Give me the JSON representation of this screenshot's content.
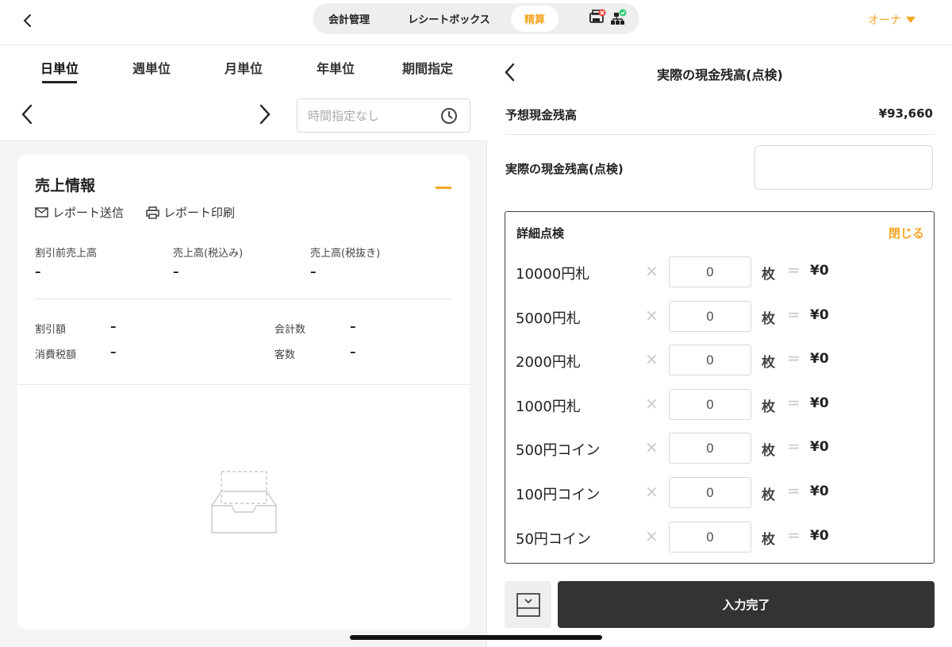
{
  "header": {
    "segments": [
      "会計管理",
      "レシートボックス",
      "精算"
    ],
    "active_segment": "精算",
    "owner_label": "オーナ"
  },
  "left": {
    "tabs": [
      "日単位",
      "週単位",
      "月単位",
      "年単位",
      "期間指定"
    ],
    "active_tab": "日単位",
    "time_placeholder": "時間指定なし",
    "card": {
      "title": "売上情報",
      "send_report": "レポート送信",
      "print_report": "レポート印刷",
      "metrics_top": [
        {
          "label": "割引前売上高",
          "value": "–"
        },
        {
          "label": "売上高(税込み)",
          "value": "–"
        },
        {
          "label": "売上高(税抜き)",
          "value": "–"
        }
      ],
      "metrics_bottom": [
        {
          "label": "割引額",
          "value": "–"
        },
        {
          "label": "会計数",
          "value": "–"
        },
        {
          "label": "消費税額",
          "value": "–"
        },
        {
          "label": "客数",
          "value": "–"
        }
      ]
    }
  },
  "right": {
    "title": "実際の現金残高(点検)",
    "expected_label": "予想現金残高",
    "expected_value": "¥93,660",
    "actual_label": "実際の現金残高(点検)",
    "actual_value": "",
    "detail_title": "詳細点検",
    "close_label": "閉じる",
    "times_symbol": "×",
    "equals_symbol": "=",
    "unit_label": "枚",
    "rows": [
      {
        "denom": "10000円札",
        "qty": "0",
        "amount": "¥0"
      },
      {
        "denom": "5000円札",
        "qty": "0",
        "amount": "¥0"
      },
      {
        "denom": "2000円札",
        "qty": "0",
        "amount": "¥0"
      },
      {
        "denom": "1000円札",
        "qty": "0",
        "amount": "¥0"
      },
      {
        "denom": "500円コイン",
        "qty": "0",
        "amount": "¥0"
      },
      {
        "denom": "100円コイン",
        "qty": "0",
        "amount": "¥0"
      },
      {
        "denom": "50円コイン",
        "qty": "0",
        "amount": "¥0"
      }
    ],
    "done_label": "入力完了"
  },
  "colors": {
    "accent": "#f5a623",
    "dark_button": "#333333"
  }
}
